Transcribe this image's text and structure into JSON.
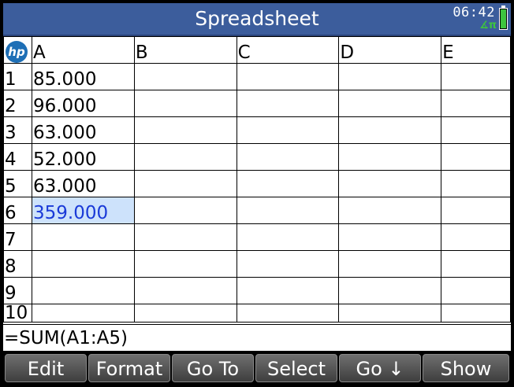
{
  "app": {
    "title": "Spreadsheet",
    "clock": "06:42",
    "angle_mode": "∡π",
    "battery_icon": "battery-icon",
    "logo": "hp"
  },
  "grid": {
    "columns": [
      "A",
      "B",
      "C",
      "D",
      "E"
    ],
    "rows": [
      {
        "label": "1",
        "cells": [
          "85.000",
          "",
          "",
          "",
          ""
        ]
      },
      {
        "label": "2",
        "cells": [
          "96.000",
          "",
          "",
          "",
          ""
        ]
      },
      {
        "label": "3",
        "cells": [
          "63.000",
          "",
          "",
          "",
          ""
        ]
      },
      {
        "label": "4",
        "cells": [
          "52.000",
          "",
          "",
          "",
          ""
        ]
      },
      {
        "label": "5",
        "cells": [
          "63.000",
          "",
          "",
          "",
          ""
        ]
      },
      {
        "label": "6",
        "cells": [
          "359.000",
          "",
          "",
          "",
          ""
        ]
      },
      {
        "label": "7",
        "cells": [
          "",
          "",
          "",
          "",
          ""
        ]
      },
      {
        "label": "8",
        "cells": [
          "",
          "",
          "",
          "",
          ""
        ]
      },
      {
        "label": "9",
        "cells": [
          "",
          "",
          "",
          "",
          ""
        ]
      },
      {
        "label": "10",
        "cells": [
          "",
          "",
          "",
          "",
          ""
        ]
      }
    ],
    "selected_cell": "A6",
    "selection_color": "#cde2fb",
    "selection_text_color": "#1a3ad8"
  },
  "entry_line": "=SUM(A1:A5)",
  "softkeys": [
    "Edit",
    "Format",
    "Go To",
    "Select",
    "Go ↓",
    "Show"
  ],
  "colors": {
    "titlebar": "#3c5d9c",
    "battery": "#3ec43e"
  }
}
